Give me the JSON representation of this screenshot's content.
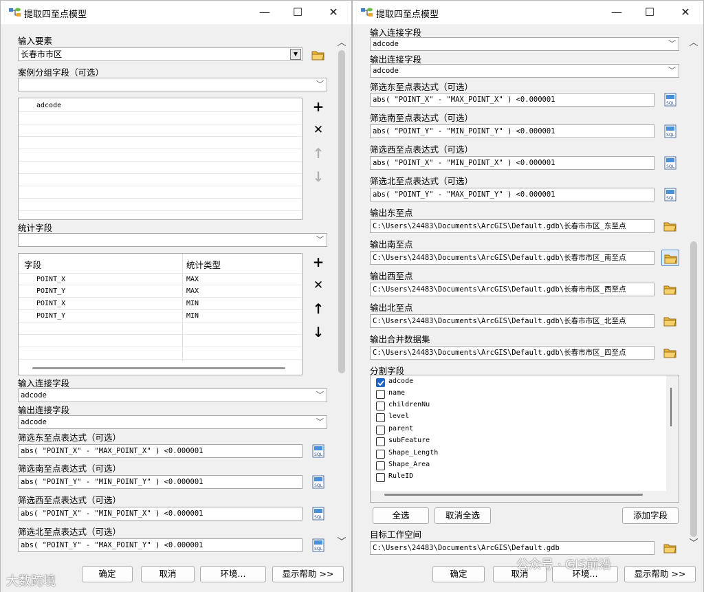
{
  "window_title": "提取四至点模型",
  "win_controls": {
    "minimize": "—",
    "maximize": "☐",
    "close": "✕"
  },
  "input_feature": {
    "label": "输入要素",
    "value": "长春市市区"
  },
  "case_group": {
    "label": "案例分组字段（可选）",
    "value": "",
    "items": [
      "adcode"
    ]
  },
  "stats": {
    "label": "统计字段",
    "value": "",
    "col_field": "字段",
    "col_type": "统计类型",
    "rows": [
      {
        "field": "POINT_X",
        "type": "MAX"
      },
      {
        "field": "POINT_Y",
        "type": "MAX"
      },
      {
        "field": "POINT_X",
        "type": "MIN"
      },
      {
        "field": "POINT_Y",
        "type": "MIN"
      }
    ]
  },
  "in_join": {
    "label": "输入连接字段",
    "value": "adcode"
  },
  "out_join": {
    "label": "输出连接字段",
    "value": "adcode"
  },
  "east_expr": {
    "label": "筛选东至点表达式（可选）",
    "value": "abs( \"POINT_X\" - \"MAX_POINT_X\" ) <0.000001"
  },
  "south_expr": {
    "label": "筛选南至点表达式（可选）",
    "value": "abs( \"POINT_Y\" - \"MIN_POINT_Y\" ) <0.000001"
  },
  "west_expr": {
    "label": "筛选西至点表达式（可选）",
    "value": "abs( \"POINT_X\" - \"MIN_POINT_X\" ) <0.000001"
  },
  "north_expr": {
    "label": "筛选北至点表达式（可选）",
    "value": "abs( \"POINT_Y\" - \"MAX_POINT_Y\" ) <0.000001"
  },
  "out_east": {
    "label": "输出东至点",
    "value": "C:\\Users\\24483\\Documents\\ArcGIS\\Default.gdb\\长春市市区_东至点"
  },
  "out_south": {
    "label": "输出南至点",
    "value": "C:\\Users\\24483\\Documents\\ArcGIS\\Default.gdb\\长春市市区_南至点"
  },
  "out_west": {
    "label": "输出西至点",
    "value": "C:\\Users\\24483\\Documents\\ArcGIS\\Default.gdb\\长春市市区_西至点"
  },
  "out_north": {
    "label": "输出北至点",
    "value": "C:\\Users\\24483\\Documents\\ArcGIS\\Default.gdb\\长春市市区_北至点"
  },
  "out_merge": {
    "label": "输出合并数据集",
    "value": "C:\\Users\\24483\\Documents\\ArcGIS\\Default.gdb\\长春市市区_四至点"
  },
  "split": {
    "label": "分割字段",
    "items": [
      {
        "name": "adcode",
        "checked": true
      },
      {
        "name": "name",
        "checked": false
      },
      {
        "name": "childrenNu",
        "checked": false
      },
      {
        "name": "level",
        "checked": false
      },
      {
        "name": "parent",
        "checked": false
      },
      {
        "name": "subFeature",
        "checked": false
      },
      {
        "name": "Shape_Length",
        "checked": false
      },
      {
        "name": "Shape_Area",
        "checked": false
      },
      {
        "name": "RuleID",
        "checked": false
      }
    ]
  },
  "split_buttons": {
    "select_all": "全选",
    "clear_all": "取消全选",
    "add_field": "添加字段"
  },
  "workspace": {
    "label": "目标工作空间",
    "value": "C:\\Users\\24483\\Documents\\ArcGIS\\Default.gdb"
  },
  "footer": {
    "ok": "确定",
    "cancel": "取消",
    "env": "环境...",
    "help": "显示帮助 >>"
  },
  "watermarks": {
    "left": "大数跨境",
    "right": "公众号 · GIS前沿"
  },
  "colors": {
    "accent": "#1a66c9"
  }
}
